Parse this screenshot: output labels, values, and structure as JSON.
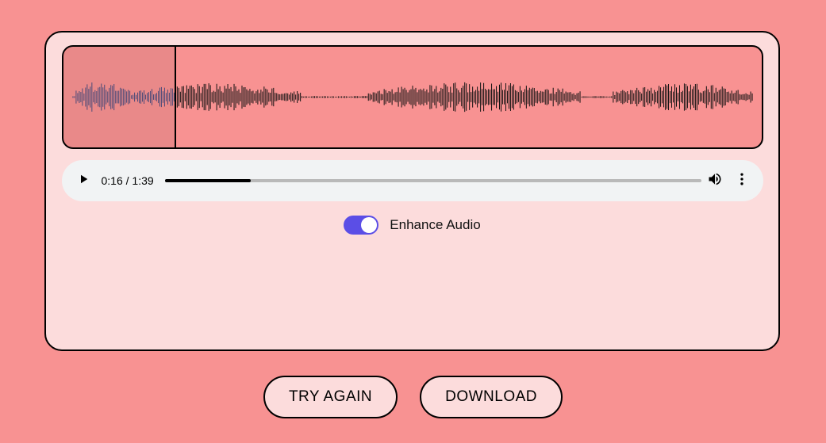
{
  "player": {
    "current_time": "0:16",
    "duration": "1:39",
    "time_display": "0:16 / 1:39",
    "progress_pct": 16
  },
  "waveform": {
    "playhead_pct": 16
  },
  "toggle": {
    "label": "Enhance Audio",
    "on": true
  },
  "buttons": {
    "try_again": "TRY AGAIN",
    "download": "DOWNLOAD"
  }
}
